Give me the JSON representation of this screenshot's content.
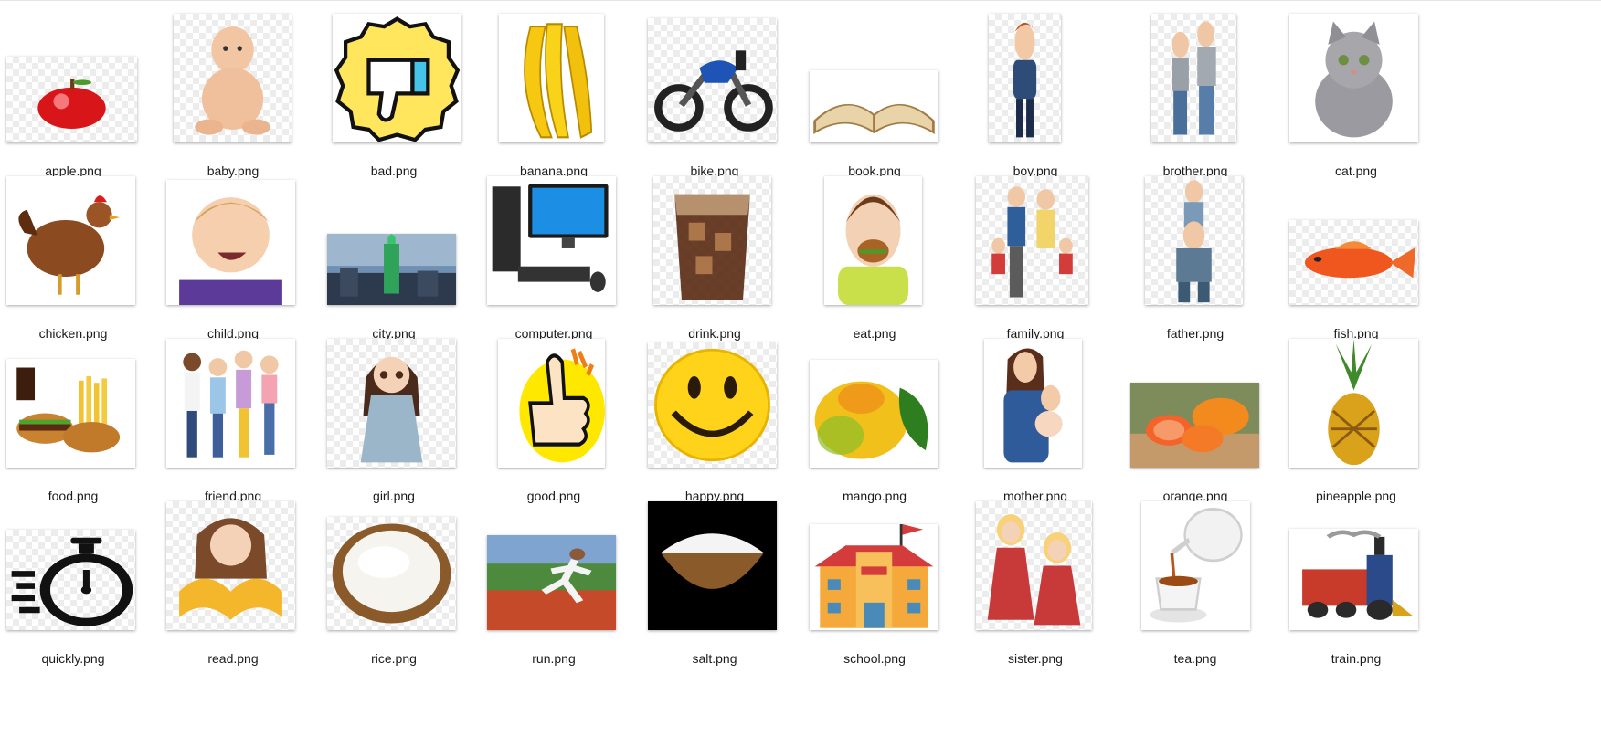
{
  "files": [
    {
      "name": "apple.png",
      "icon": "apple-icon"
    },
    {
      "name": "baby.png",
      "icon": "baby-icon"
    },
    {
      "name": "bad.png",
      "icon": "thumbs-down-icon"
    },
    {
      "name": "banana.png",
      "icon": "banana-icon"
    },
    {
      "name": "bike.png",
      "icon": "motorbike-icon"
    },
    {
      "name": "book.png",
      "icon": "open-book-icon"
    },
    {
      "name": "boy.png",
      "icon": "boy-icon"
    },
    {
      "name": "brother.png",
      "icon": "brothers-icon"
    },
    {
      "name": "cat.png",
      "icon": "cat-icon"
    },
    {
      "name": "chicken.png",
      "icon": "chicken-icon"
    },
    {
      "name": "child.png",
      "icon": "child-icon"
    },
    {
      "name": "city.png",
      "icon": "city-skyline-icon"
    },
    {
      "name": "computer.png",
      "icon": "computer-icon"
    },
    {
      "name": "drink.png",
      "icon": "drink-glass-icon"
    },
    {
      "name": "eat.png",
      "icon": "eating-boy-icon"
    },
    {
      "name": "family.png",
      "icon": "family-icon"
    },
    {
      "name": "father.png",
      "icon": "father-child-icon"
    },
    {
      "name": "fish.png",
      "icon": "fish-icon"
    },
    {
      "name": "food.png",
      "icon": "fast-food-icon"
    },
    {
      "name": "friend.png",
      "icon": "friends-icon"
    },
    {
      "name": "girl.png",
      "icon": "girl-icon"
    },
    {
      "name": "good.png",
      "icon": "thumbs-up-icon"
    },
    {
      "name": "happy.png",
      "icon": "smiley-icon"
    },
    {
      "name": "mango.png",
      "icon": "mango-icon"
    },
    {
      "name": "mother.png",
      "icon": "mother-baby-icon"
    },
    {
      "name": "orange.png",
      "icon": "orange-fruit-icon"
    },
    {
      "name": "pineapple.png",
      "icon": "pineapple-icon"
    },
    {
      "name": "quickly.png",
      "icon": "stopwatch-icon"
    },
    {
      "name": "read.png",
      "icon": "reading-girl-icon"
    },
    {
      "name": "rice.png",
      "icon": "rice-bowl-icon"
    },
    {
      "name": "run.png",
      "icon": "runner-icon"
    },
    {
      "name": "salt.png",
      "icon": "salt-bowl-icon"
    },
    {
      "name": "school.png",
      "icon": "school-building-icon"
    },
    {
      "name": "sister.png",
      "icon": "sisters-icon"
    },
    {
      "name": "tea.png",
      "icon": "teapot-cup-icon"
    },
    {
      "name": "train.png",
      "icon": "train-icon"
    }
  ]
}
